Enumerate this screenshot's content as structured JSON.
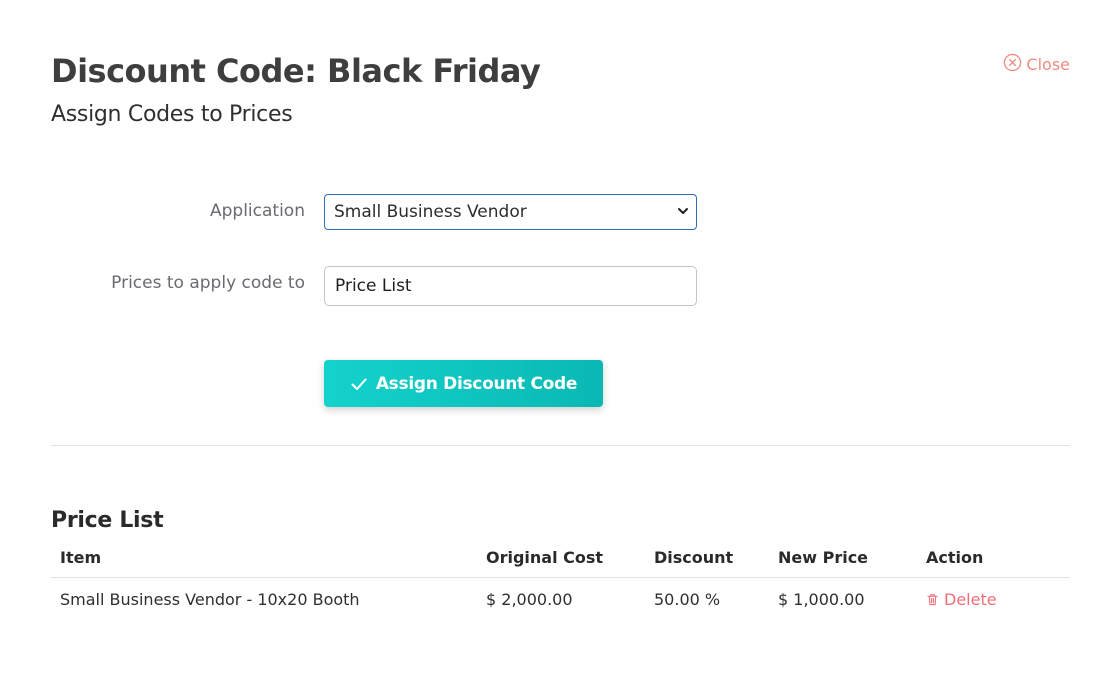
{
  "header": {
    "title": "Discount Code: Black Friday",
    "subtitle": "Assign Codes to Prices",
    "close_label": "Close"
  },
  "form": {
    "application_label": "Application",
    "application_value": "Small Business Vendor",
    "prices_label": "Prices to apply code to",
    "prices_value": "Price List",
    "assign_button_label": "Assign Discount Code"
  },
  "price_list": {
    "title": "Price List",
    "columns": [
      "Item",
      "Original Cost",
      "Discount",
      "New Price",
      "Action"
    ],
    "rows": [
      {
        "item": "Small Business Vendor - 10x20 Booth",
        "original_cost": "$ 2,000.00",
        "discount": "50.00 %",
        "new_price": "$ 1,000.00",
        "action": "Delete"
      }
    ]
  },
  "colors": {
    "accent": "#14d2cc",
    "close": "#f08b80",
    "delete": "#ef6f79",
    "select_border": "#2f6fb5"
  },
  "icons": {
    "close": "close-circle-icon",
    "dropdown": "chevron-down-icon",
    "assign": "check-icon",
    "delete": "trash-icon"
  }
}
